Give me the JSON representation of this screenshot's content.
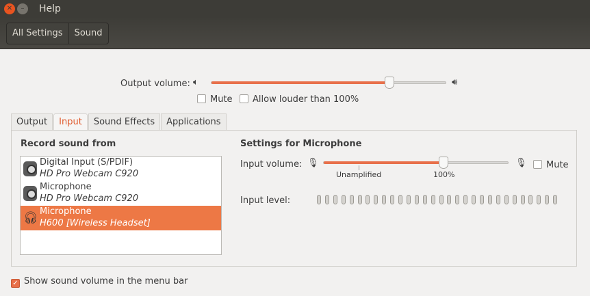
{
  "window": {
    "title": "Help"
  },
  "toolbar": {
    "breadcrumbs": [
      "All Settings",
      "Sound"
    ]
  },
  "output_volume": {
    "label": "Output volume:",
    "value_fraction": 0.76,
    "mute_label": "Mute",
    "mute_checked": false,
    "louder_label": "Allow louder than 100%",
    "louder_checked": false
  },
  "tabs": [
    "Output",
    "Input",
    "Sound Effects",
    "Applications"
  ],
  "active_tab": "Input",
  "record": {
    "heading": "Record sound from",
    "devices": [
      {
        "name": "Digital Input (S/PDIF)",
        "detail": "HD Pro Webcam C920",
        "icon": "webcam-icon",
        "selected": false
      },
      {
        "name": "Microphone",
        "detail": "HD Pro Webcam C920",
        "icon": "webcam-icon",
        "selected": false
      },
      {
        "name": "Microphone",
        "detail": "H600 [Wireless Headset]",
        "icon": "headset-icon",
        "selected": true
      }
    ]
  },
  "settings": {
    "heading": "Settings for Microphone",
    "input_volume_label": "Input volume:",
    "input_volume_fraction": 0.65,
    "mark_unamplified": "Unamplified",
    "mark_100": "100%",
    "mute_label": "Mute",
    "mute_checked": false,
    "input_level_label": "Input level:",
    "input_level_fraction": 0,
    "level_segments": 30
  },
  "footer": {
    "show_volume_label": "Show sound volume in the menu bar",
    "show_volume_checked": true
  },
  "colors": {
    "accent": "#ed7845",
    "titlebar": "#3d3c37",
    "close": "#e95420"
  }
}
